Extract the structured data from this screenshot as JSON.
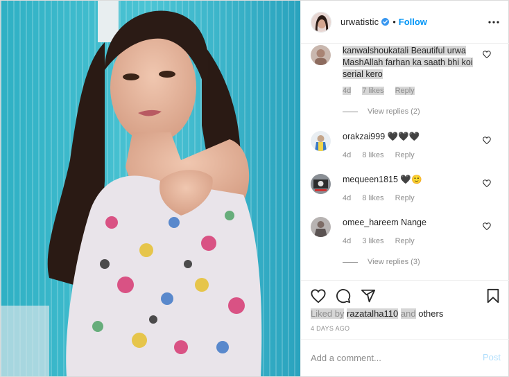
{
  "header": {
    "username": "urwatistic",
    "separator": "•",
    "follow_label": "Follow"
  },
  "comments": [
    {
      "username": "kanwalshoukatali",
      "text": "Beautiful urwa MashAllah farhan ka saath bhi koi serial kero",
      "time": "4d",
      "likes": "7 likes",
      "reply_label": "Reply",
      "view_replies": "View replies (2)"
    },
    {
      "username": "orakzai999",
      "text": "🖤🖤🖤",
      "time": "4d",
      "likes": "8 likes",
      "reply_label": "Reply"
    },
    {
      "username": "mequeen1815",
      "text": "🖤🙂",
      "time": "4d",
      "likes": "8 likes",
      "reply_label": "Reply"
    },
    {
      "username": "omee_hareem",
      "text": "Nange",
      "time": "4d",
      "likes": "3 likes",
      "reply_label": "Reply",
      "view_replies": "View replies (3)"
    }
  ],
  "likes_line": {
    "prefix": "Liked by",
    "user": "razatalha110",
    "connector": "and",
    "suffix": "others"
  },
  "timestamp": "4 DAYS AGO",
  "add_comment": {
    "placeholder": "Add a comment...",
    "post_label": "Post"
  },
  "colors": {
    "accent": "#0095f6",
    "post_disabled": "#b2dffc",
    "meta_grey": "#8e8e8e"
  },
  "icons": [
    "verified-badge-icon",
    "more-options-icon",
    "heart-icon",
    "comment-icon",
    "share-icon",
    "bookmark-icon"
  ]
}
